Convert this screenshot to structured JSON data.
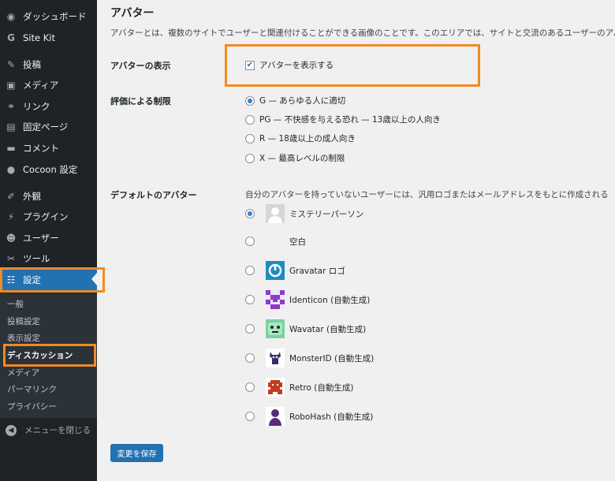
{
  "sidebar": {
    "items": [
      {
        "label": "ダッシュボード",
        "icon": "dashboard-icon",
        "glyph": "◉"
      },
      {
        "label": "Site Kit",
        "icon": "site-kit-icon",
        "glyph": "G"
      },
      {
        "label": "投稿",
        "icon": "pin-icon",
        "glyph": "✎"
      },
      {
        "label": "メディア",
        "icon": "media-icon",
        "glyph": "▣"
      },
      {
        "label": "リンク",
        "icon": "link-icon",
        "glyph": "⚭"
      },
      {
        "label": "固定ページ",
        "icon": "page-icon",
        "glyph": "▤"
      },
      {
        "label": "コメント",
        "icon": "comment-icon",
        "glyph": "▬"
      },
      {
        "label": "Cocoon 設定",
        "icon": "cocoon-icon",
        "glyph": "●"
      },
      {
        "label": "外観",
        "icon": "appearance-icon",
        "glyph": "✐"
      },
      {
        "label": "プラグイン",
        "icon": "plugin-icon",
        "glyph": "⚡"
      },
      {
        "label": "ユーザー",
        "icon": "user-icon",
        "glyph": "☻"
      },
      {
        "label": "ツール",
        "icon": "tool-icon",
        "glyph": "✂"
      },
      {
        "label": "設定",
        "icon": "settings-icon",
        "glyph": "☷"
      }
    ],
    "submenu": [
      "一般",
      "投稿設定",
      "表示設定",
      "ディスカッション",
      "メディア",
      "パーマリンク",
      "プライバシー"
    ],
    "collapse_label": "メニューを閉じる"
  },
  "main": {
    "title": "アバター",
    "description": "アバターとは、複数のサイトでユーザーと関連付けることができる画像のことです。このエリアでは、サイトと交流のあるユーザーのアバ",
    "display": {
      "label": "アバターの表示",
      "checkbox_label": "アバターを表示する",
      "checked": true
    },
    "rating": {
      "label": "評価による制限",
      "options": [
        {
          "label": "G — あらゆる人に適切",
          "selected": true
        },
        {
          "label": "PG — 不快感を与える恐れ — 13歳以上の人向き",
          "selected": false
        },
        {
          "label": "R — 18歳以上の成人向き",
          "selected": false
        },
        {
          "label": "X — 最高レベルの制限",
          "selected": false
        }
      ]
    },
    "default_avatar": {
      "label": "デフォルトのアバター",
      "description": "自分のアバターを持っていないユーザーには、汎用ロゴまたはメールアドレスをもとに作成される",
      "options": [
        {
          "label": "ミステリーパーソン",
          "selected": true,
          "icon": "mystery-person-icon"
        },
        {
          "label": "空白",
          "selected": false,
          "icon": "blank-icon"
        },
        {
          "label": "Gravatar ロゴ",
          "selected": false,
          "icon": "gravatar-logo-icon"
        },
        {
          "label": "Identicon (自動生成)",
          "selected": false,
          "icon": "identicon-icon"
        },
        {
          "label": "Wavatar (自動生成)",
          "selected": false,
          "icon": "wavatar-icon"
        },
        {
          "label": "MonsterID (自動生成)",
          "selected": false,
          "icon": "monsterid-icon"
        },
        {
          "label": "Retro (自動生成)",
          "selected": false,
          "icon": "retro-icon"
        },
        {
          "label": "RoboHash (自動生成)",
          "selected": false,
          "icon": "robohash-icon"
        }
      ]
    },
    "save_label": "変更を保存"
  },
  "colors": {
    "sidebar_bg": "#1d2327",
    "accent": "#2271b1",
    "highlight": "#f08a24"
  }
}
